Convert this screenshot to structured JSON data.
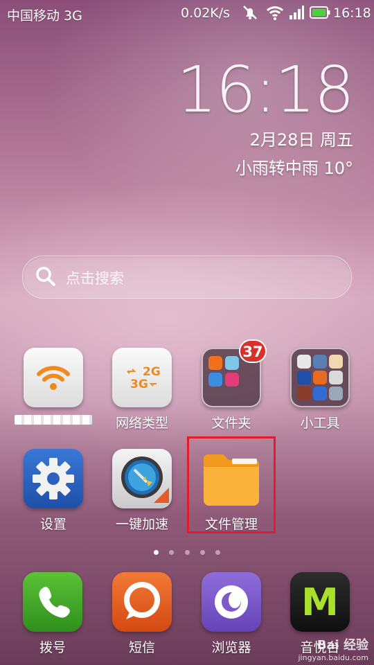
{
  "status_bar": {
    "carrier": "中国移动 3G",
    "speed": "0.02K/s",
    "time": "16:18",
    "battery_color": "#49d43e"
  },
  "clock_widget": {
    "time": "16:18",
    "date": "2月28日 周五",
    "weather": "小雨转中雨  10°"
  },
  "search": {
    "placeholder": "点击搜索"
  },
  "apps_row1": [
    {
      "label": "",
      "icon": "wifi-icon",
      "redacted": true
    },
    {
      "label": "网络类型",
      "icon": "network-type-icon"
    },
    {
      "label": "文件夹",
      "icon": "folder-icon",
      "badge": "37"
    },
    {
      "label": "小工具",
      "icon": "tools-folder-icon"
    }
  ],
  "apps_row2": [
    {
      "label": "设置",
      "icon": "gear-icon"
    },
    {
      "label": "一键加速",
      "icon": "broom-icon"
    },
    {
      "label": "文件管理",
      "icon": "file-manager-icon",
      "highlighted": true
    }
  ],
  "network_icon_text": {
    "top": "2G",
    "bottom": "3G"
  },
  "page_indicator": {
    "count": 5,
    "active": 0
  },
  "dock": [
    {
      "label": "拨号",
      "icon": "phone-icon",
      "color": "#3da12a"
    },
    {
      "label": "短信",
      "icon": "message-icon",
      "color": "#e35a1f"
    },
    {
      "label": "浏览器",
      "icon": "browser-icon",
      "color": "#7b5bc9"
    },
    {
      "label": "音悦台",
      "icon": "yinyuetai-icon",
      "color": "#1d1d1d"
    }
  ],
  "dock_m_letter": "M",
  "watermark": {
    "line1": "Bai 经验",
    "line2": "jingyan.baidu.com"
  }
}
